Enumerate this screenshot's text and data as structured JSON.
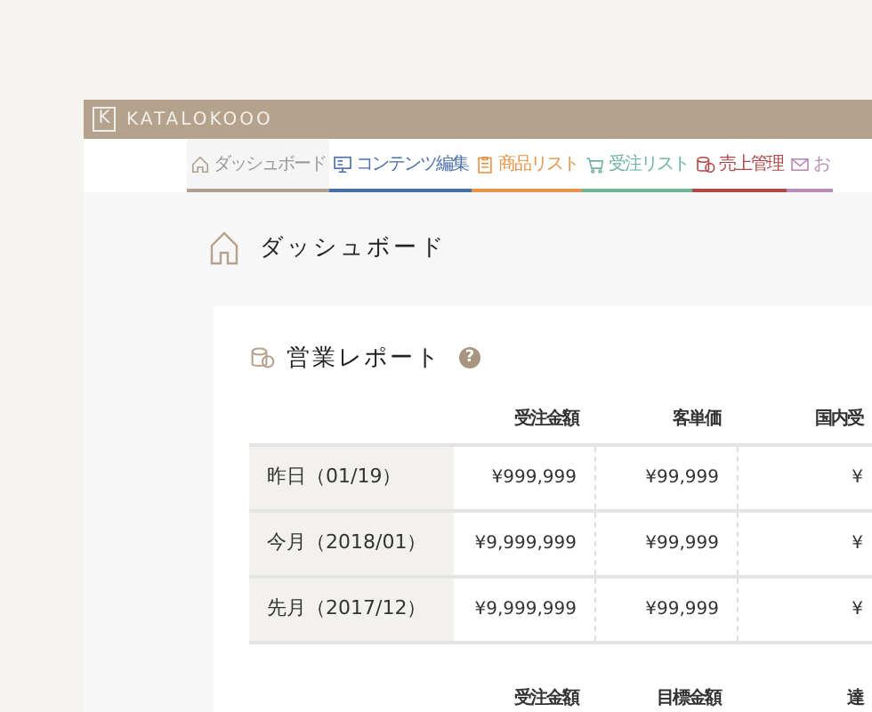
{
  "header": {
    "logo_letter": "K",
    "brand": "KATALOKOOO"
  },
  "tabs": [
    {
      "label": "ダッシュボード",
      "kind": "home",
      "color": "#b0a08e",
      "selected": true
    },
    {
      "label": "コンテンツ編集",
      "kind": "monitor",
      "color": "#4a6fa8",
      "selected": false
    },
    {
      "label": "商品リスト",
      "kind": "clipboard",
      "color": "#e8944a",
      "selected": false
    },
    {
      "label": "受注リスト",
      "kind": "cart",
      "color": "#6fb59a",
      "selected": false
    },
    {
      "label": "売上管理",
      "kind": "coins",
      "color": "#b04a4a",
      "selected": false
    },
    {
      "label": "お",
      "kind": "mail",
      "color": "#b78cb8",
      "selected": false
    }
  ],
  "page_title": "ダッシュボード",
  "report": {
    "title": "営業レポート",
    "help": "?",
    "tables": [
      {
        "columns": [
          "受注金額",
          "客単価",
          "国内受"
        ],
        "rows": [
          {
            "label": "昨日（01/19）",
            "cells": [
              "¥999,999",
              "¥99,999",
              "¥"
            ]
          },
          {
            "label": "今月（2018/01）",
            "cells": [
              "¥9,999,999",
              "¥99,999",
              "¥"
            ]
          },
          {
            "label": "先月（2017/12）",
            "cells": [
              "¥9,999,999",
              "¥99,999",
              "¥"
            ]
          }
        ]
      },
      {
        "columns": [
          "受注金額",
          "目標金額",
          "達"
        ]
      }
    ]
  }
}
